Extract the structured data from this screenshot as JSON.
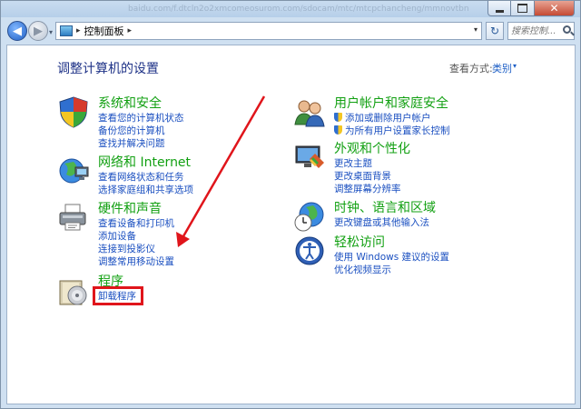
{
  "window": {
    "title_watermark": "baidu.com/f.dtcln2o2xmcomeosurom.com/sdocam/mtc/mtcpchancheng/mmnovtbn"
  },
  "navbar": {
    "back_glyph": "◀",
    "forward_glyph": "▶",
    "dropdown_glyph": "▾",
    "breadcrumb_separator": "▸",
    "breadcrumb": "控制面板",
    "breadcrumb_arrow": "▸",
    "address_dropdown": "▾",
    "refresh_glyph": "↻",
    "search_placeholder": "搜索控制..."
  },
  "window_buttons": {
    "close_glyph": "✕"
  },
  "main": {
    "title": "调整计算机的设置",
    "view_by_label": "查看方式:",
    "view_by_value": "类别",
    "view_by_arrow": "▾"
  },
  "categories": [
    {
      "title": "系统和安全",
      "icon": "shield-icon",
      "links": [
        "查看您的计算机状态",
        "备份您的计算机",
        "查找并解决问题"
      ]
    },
    {
      "title": "网络和 Internet",
      "icon": "network-globe-icon",
      "links": [
        "查看网络状态和任务",
        "选择家庭组和共享选项"
      ]
    },
    {
      "title": "硬件和声音",
      "icon": "printer-icon",
      "links": [
        "查看设备和打印机",
        "添加设备",
        "连接到投影仪",
        "调整常用移动设置"
      ]
    },
    {
      "title": "程序",
      "icon": "programs-icon",
      "links": [
        "卸载程序"
      ]
    },
    {
      "title": "用户帐户和家庭安全",
      "icon": "users-icon",
      "links": [
        "添加或删除用户帐户",
        "为所有用户设置家长控制"
      ]
    },
    {
      "title": "外观和个性化",
      "icon": "appearance-icon",
      "links": [
        "更改主题",
        "更改桌面背景",
        "调整屏幕分辨率"
      ]
    },
    {
      "title": "时钟、语言和区域",
      "icon": "clock-globe-icon",
      "links": [
        "更改键盘或其他输入法"
      ]
    },
    {
      "title": "轻松访问",
      "icon": "ease-of-access-icon",
      "links": [
        "使用 Windows 建议的设置",
        "优化视频显示"
      ]
    }
  ],
  "colors": {
    "category_title": "#12a012",
    "link": "#1a4fc0",
    "page_title": "#1e3287",
    "annotation_red": "#e0151b"
  }
}
